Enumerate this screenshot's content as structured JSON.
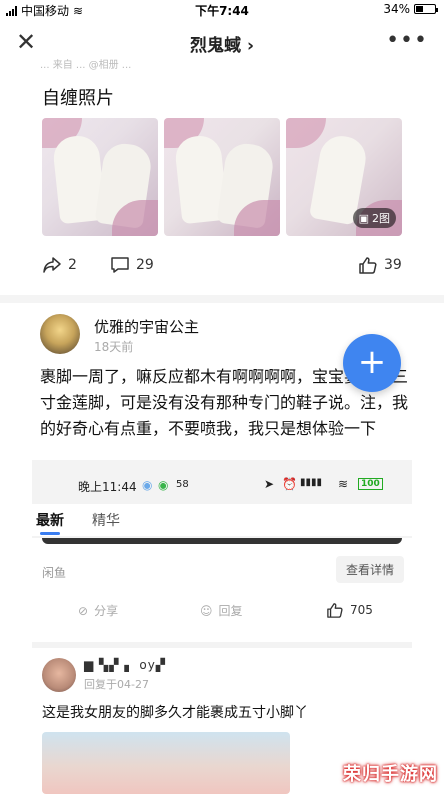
{
  "status_bar": {
    "carrier": "中国移动",
    "time": "下午7:44",
    "battery": "34%"
  },
  "nav": {
    "title": "烈鬼蜮 ›"
  },
  "post1": {
    "blurred_meta": "... 来自 ... @相册 ...",
    "section_title": "自缠照片",
    "image_count": "2图",
    "shares": "2",
    "comments": "29",
    "likes": "39"
  },
  "post2": {
    "username": "优雅的宇宙公主",
    "time": "18天前",
    "body": "裹脚一周了，嘛反应都木有啊啊啊啊，宝宝要裹成三寸金莲脚，可是没有没有那种专门的鞋子说。注，我的好奇心有点重，不要喷我，我只是想体验一下",
    "fab_label": "+"
  },
  "inner": {
    "time": "晚上11:44",
    "status_num": "58",
    "battery": "100",
    "tab_latest": "最新",
    "tab_featured": "精华",
    "source": "闲鱼",
    "detail_button": "查看详情",
    "share_label": "分享",
    "reply_label": "回复",
    "like_count": "705",
    "comment_user": "▆ ▚▞ ▖ oy▞",
    "comment_reply": "回复于04-27",
    "comment_body": "这是我女朋友的脚多久才能裹成五寸小脚丫"
  },
  "watermark": "荣归手游网",
  "colors": {
    "accent": "#3f85f0",
    "fab": "#3f85f0"
  }
}
